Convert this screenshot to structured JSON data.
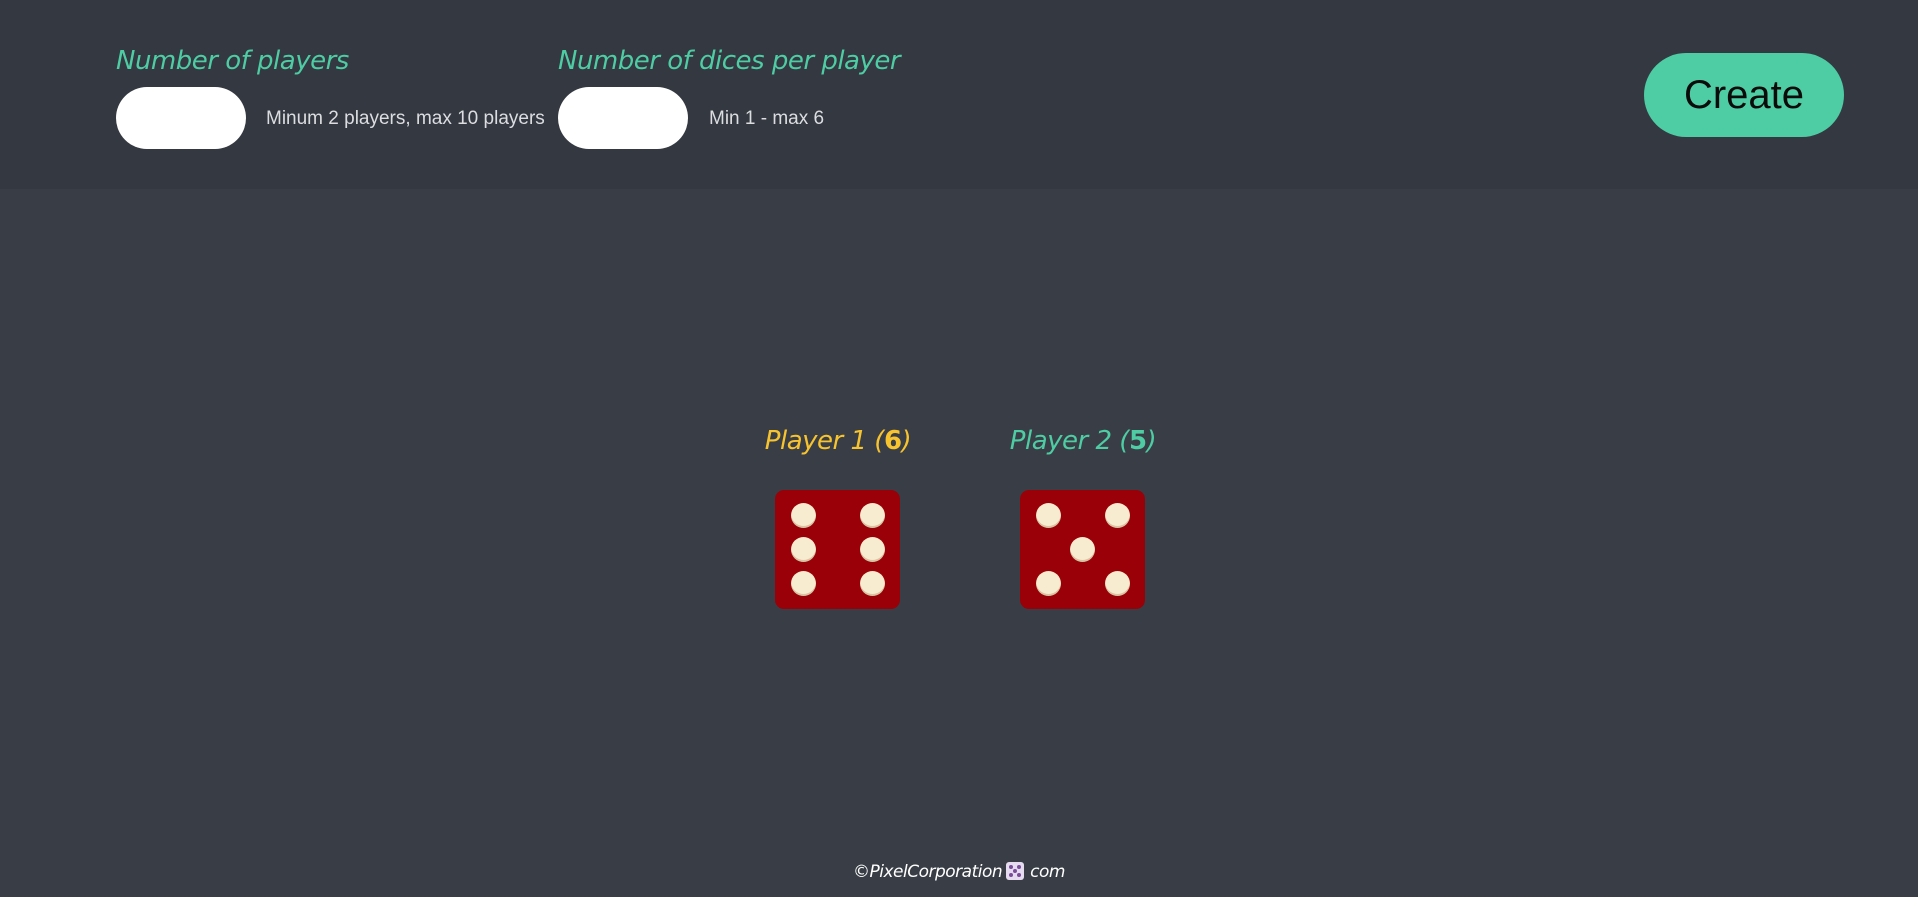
{
  "form": {
    "players": {
      "label": "Number of players",
      "value": "",
      "placeholder": "",
      "hint": "Minum 2 players, max 10 players"
    },
    "dices": {
      "label": "Number of dices per player",
      "value": "",
      "placeholder": "",
      "hint": "Min 1 - max 6"
    },
    "create_label": "Create"
  },
  "players": [
    {
      "name": "Player 1",
      "score": "6",
      "color": "#f7c32e",
      "die_face": 6
    },
    {
      "name": "Player 2",
      "score": "5",
      "color": "#4ecca3",
      "die_face": 5
    }
  ],
  "footer": {
    "prefix": "©PixelCorporation",
    "icon": "dice-icon",
    "suffix": "com"
  },
  "colors": {
    "accent": "#4ecca3",
    "player1": "#f7c32e",
    "die": "#9a0007",
    "background": "#393e46",
    "header": "#333841"
  }
}
